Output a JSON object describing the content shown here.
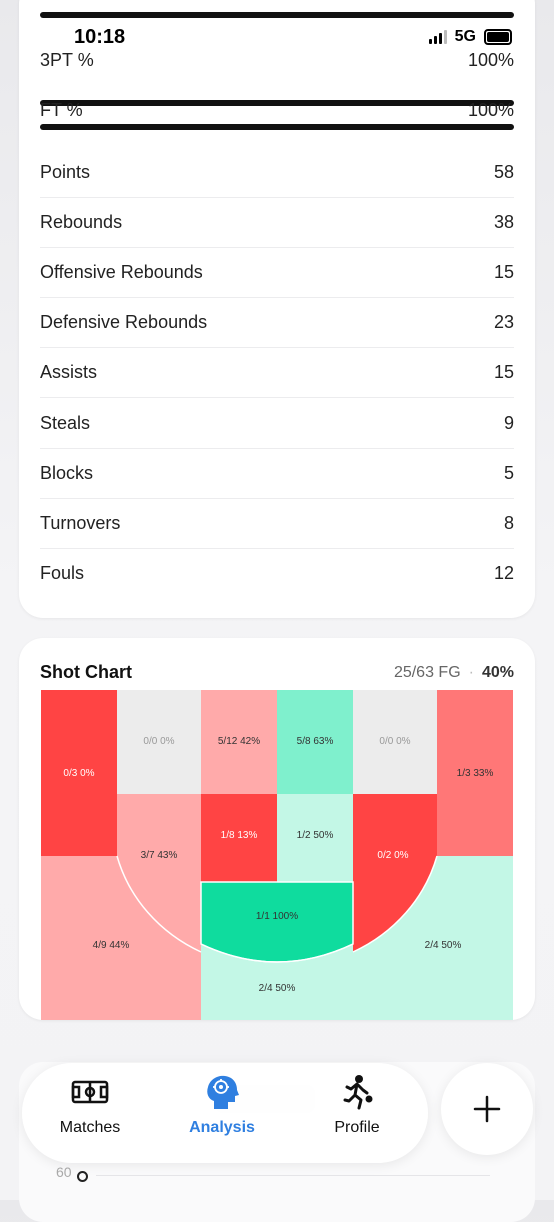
{
  "status_bar": {
    "time": "10:18",
    "network": "5G"
  },
  "percent_bars": [
    {
      "label": "3PT %",
      "value": "100%"
    },
    {
      "label": "FT %",
      "value": "100%"
    }
  ],
  "stats": [
    {
      "label": "Points",
      "value": "58"
    },
    {
      "label": "Rebounds",
      "value": "38"
    },
    {
      "label": "Offensive Rebounds",
      "value": "15"
    },
    {
      "label": "Defensive Rebounds",
      "value": "23"
    },
    {
      "label": "Assists",
      "value": "15"
    },
    {
      "label": "Steals",
      "value": "9"
    },
    {
      "label": "Blocks",
      "value": "5"
    },
    {
      "label": "Turnovers",
      "value": "8"
    },
    {
      "label": "Fouls",
      "value": "12"
    }
  ],
  "shot_chart": {
    "title": "Shot Chart",
    "fg_summary": "25/63 FG",
    "fg_percent": "40%",
    "zones": {
      "left_corner": "0/3 0%",
      "left_wing_top": "0/0 0%",
      "top_left": "5/12 42%",
      "top_right": "5/8 63%",
      "right_wing_top": "0/0 0%",
      "right_corner": "1/3 33%",
      "left_mid": "3/7 43%",
      "paint_left": "1/8 13%",
      "paint_right": "1/2 50%",
      "right_mid": "0/2 0%",
      "restricted": "1/1 100%",
      "left_baseline": "4/9 44%",
      "bottom_center": "2/4 50%",
      "right_baseline": "2/4 50%"
    },
    "colors": {
      "cold": "#ff4444",
      "warm": "#ffaaaa",
      "neutral": "#ececec",
      "good": "#7ff0cd",
      "great": "#0fdc9e",
      "light_good": "#c3f7e6",
      "medium_cold": "#ff7777"
    }
  },
  "background": {
    "axis_tick": "60"
  },
  "nav": {
    "items": [
      {
        "label": "Matches",
        "icon": "court-icon",
        "active": false
      },
      {
        "label": "Analysis",
        "icon": "brain-icon",
        "active": true
      },
      {
        "label": "Profile",
        "icon": "player-icon",
        "active": false
      }
    ],
    "accent": "#2f7fe0",
    "add_icon": "plus-icon"
  }
}
